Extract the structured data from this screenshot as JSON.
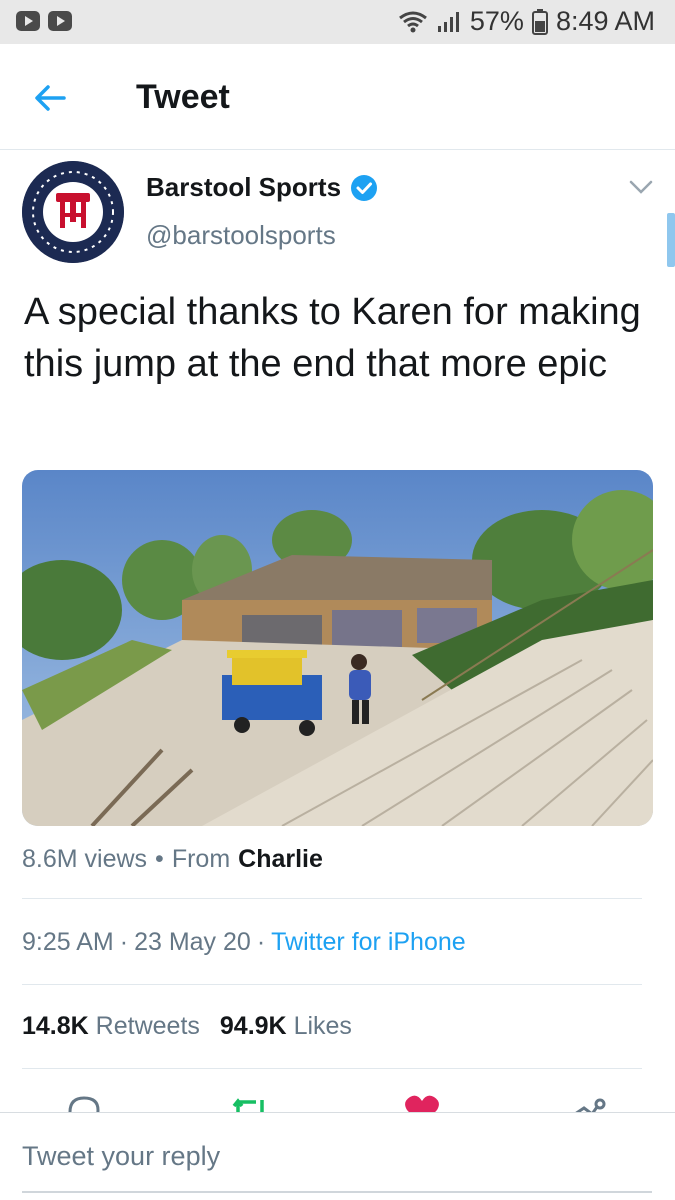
{
  "status_bar": {
    "battery": "57%",
    "time": "8:49 AM",
    "icons": [
      "youtube-icon",
      "youtube-icon",
      "wifi-icon",
      "signal-icon",
      "battery-icon"
    ]
  },
  "header": {
    "title": "Tweet",
    "back_icon": "arrow-left-icon"
  },
  "tweet": {
    "author_name": "Barstool Sports",
    "author_handle": "@barstoolsports",
    "text": "A special thanks to Karen for making this jump at the end that more epic",
    "media": {
      "type": "video"
    },
    "views": "8.6M views",
    "separator": "•",
    "from_label": "From",
    "from_name": "Charlie",
    "time": "9:25 AM",
    "dot": "·",
    "date": "23 May 20",
    "source": "Twitter for iPhone",
    "retweets_count": "14.8K",
    "retweets_label": "Retweets",
    "likes_count": "94.9K",
    "likes_label": "Likes"
  },
  "reply": {
    "placeholder": "Tweet your reply"
  },
  "colors": {
    "accent": "#1da1f2",
    "retweet": "#17bf63",
    "like": "#e0245e",
    "secondary_text": "#657786"
  }
}
